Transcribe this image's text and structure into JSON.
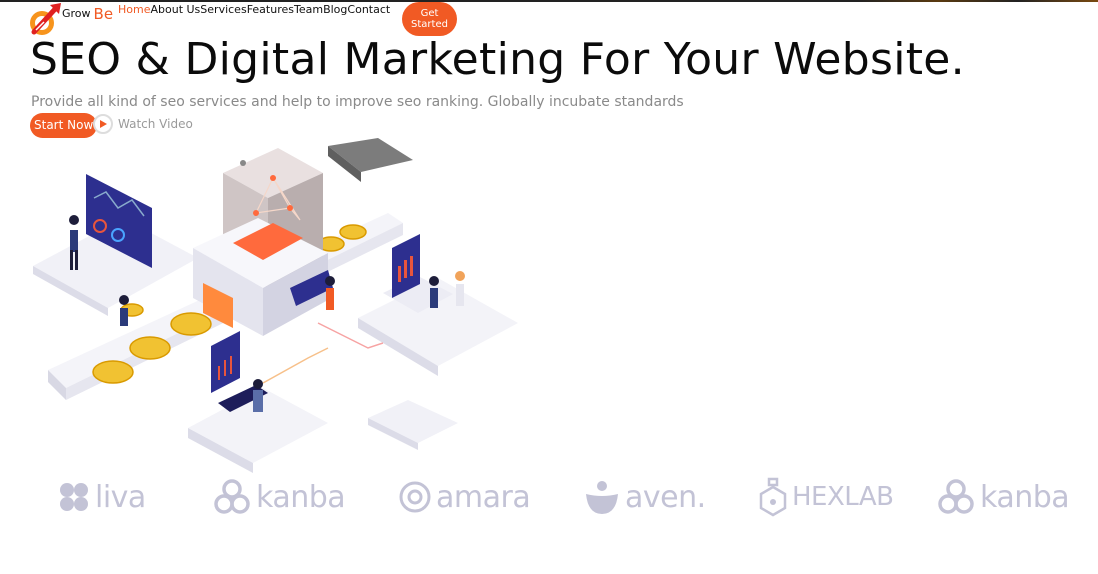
{
  "brand": {
    "grow": "Grow",
    "be": "Be"
  },
  "nav": {
    "items": [
      {
        "label": "Home",
        "active": true
      },
      {
        "label": "About Us",
        "active": false
      },
      {
        "label": "Services",
        "active": false
      },
      {
        "label": "Features",
        "active": false
      },
      {
        "label": "Team",
        "active": false
      },
      {
        "label": "Blog",
        "active": false
      },
      {
        "label": "Contact",
        "active": false
      }
    ],
    "cta_label": "Get Started"
  },
  "hero": {
    "title": "SEO & Digital Marketing For Your Website.",
    "subtitle": "Provide all kind of seo services and help to improve seo ranking. Globally incubate standards",
    "primary_button": "Start Now",
    "video_link": "Watch Video"
  },
  "brands": [
    {
      "name": "liva",
      "icon": "liva-logo-icon"
    },
    {
      "name": "kanba",
      "icon": "kanba-logo-icon"
    },
    {
      "name": "amara",
      "icon": "amara-logo-icon"
    },
    {
      "name": "aven.",
      "icon": "aven-logo-icon"
    },
    {
      "name": "HEXLAB",
      "icon": "hexlab-logo-icon"
    },
    {
      "name": "kanba",
      "icon": "kanba-logo-icon"
    }
  ],
  "colors": {
    "accent": "#f15a24",
    "logo_gray": "#c3c3d6",
    "text": "#0b0b0b",
    "muted": "#8a8a8a"
  }
}
